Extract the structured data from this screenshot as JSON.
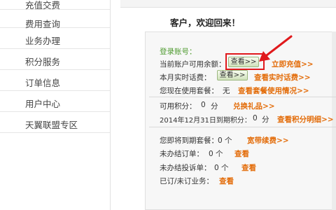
{
  "sidebar": {
    "items": [
      {
        "label": "充值交费"
      },
      {
        "label": "费用查询"
      },
      {
        "label": "业务办理"
      },
      {
        "label": "积分服务"
      },
      {
        "label": "订单信息"
      },
      {
        "label": "用户中心"
      },
      {
        "label": "天翼联盟专区"
      }
    ]
  },
  "welcome": "客户，欢迎回来！",
  "account": {
    "login_label": "登录账号：",
    "balance_label": "当前账户可用余额：",
    "view_button": "查看>>",
    "recharge_link": "立即充值>>",
    "realtime_label": "本月实时话费：",
    "realtime_link": "查看实时话费>>",
    "plan_label": "您现在使用套餐：",
    "plan_value": "无",
    "plan_link": "查看套餐使用情况>>"
  },
  "points": {
    "available_label": "可用积分：",
    "available_value": "0",
    "available_unit": "分",
    "redeem_link": "兑换礼品>>",
    "expiring_label": "2014年12月31日到期积分：",
    "expiring_value": "0",
    "expiring_unit": "分",
    "detail_link": "查看积分明细>>"
  },
  "orders": {
    "expiring_plan_label": "您即将到期套餐：",
    "expiring_plan_value": "0 个",
    "renew_link": "宽带续费>>",
    "open_orders_label": "未办结订单：",
    "open_orders_value": "0 个",
    "open_orders_link": "查看",
    "complaints_label": "未办结投诉单：",
    "complaints_value": "0 个",
    "complaints_link": "查看",
    "business_label": "已订/未订业务：",
    "business_link": "查看"
  },
  "colors": {
    "accent_orange": "#e36c09",
    "label_green": "#4d9a2e",
    "highlight_red": "#e0191c"
  }
}
